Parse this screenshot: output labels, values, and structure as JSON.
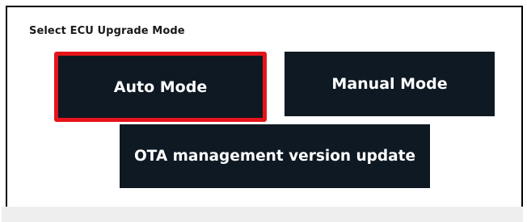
{
  "dialog": {
    "title": "Select ECU Upgrade Mode"
  },
  "buttons": {
    "auto_mode": "Auto Mode",
    "manual_mode": "Manual Mode",
    "ota_update": "OTA management version update"
  },
  "colors": {
    "button_background": "#0e1923",
    "button_text": "#ffffff",
    "selection_highlight": "#e5141a",
    "dialog_border": "#000000",
    "footer_background": "#eeeeee"
  },
  "state": {
    "selected_button": "auto_mode"
  }
}
